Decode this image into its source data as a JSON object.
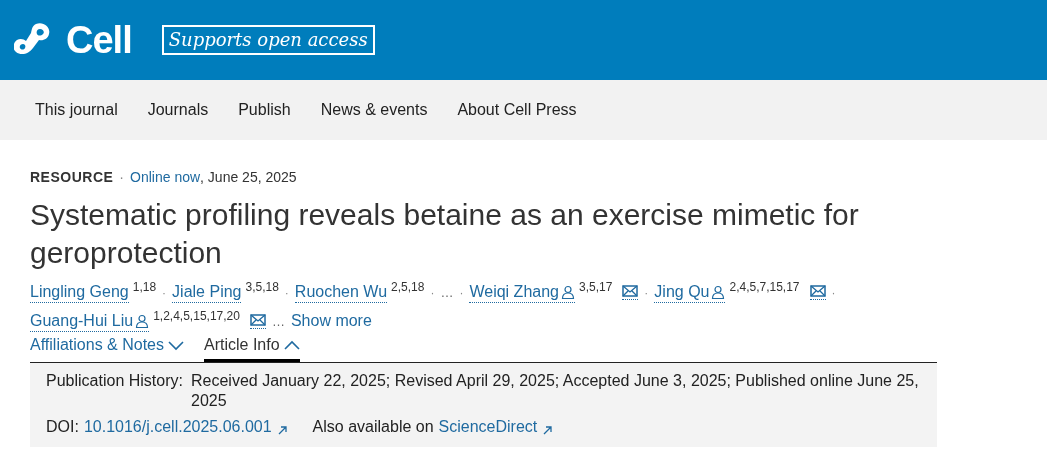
{
  "header": {
    "logo_text": "Cell",
    "badge": "Supports open access"
  },
  "nav": {
    "items": [
      "This journal",
      "Journals",
      "Publish",
      "News & events",
      "About Cell Press"
    ]
  },
  "article": {
    "type": "RESOURCE",
    "status": "Online now",
    "date": ", June 25, 2025",
    "title": "Systematic profiling reveals betaine as an exercise mimetic for geroprotection",
    "authors": [
      {
        "kind": "author",
        "name": "Lingling Geng",
        "affiliations": "1,18",
        "corresponding": false
      },
      {
        "kind": "author",
        "name": "Jiale Ping",
        "affiliations": "3,5,18",
        "corresponding": false
      },
      {
        "kind": "author",
        "name": "Ruochen Wu",
        "affiliations": "2,5,18",
        "corresponding": false
      },
      {
        "kind": "ellipsis",
        "text": "…"
      },
      {
        "kind": "author",
        "name": "Weiqi Zhang",
        "affiliations": "3,5,17",
        "corresponding": true
      },
      {
        "kind": "author",
        "name": "Jing Qu",
        "affiliations": "2,4,5,7,15,17",
        "corresponding": true
      },
      {
        "kind": "author",
        "name": "Guang-Hui Liu",
        "affiliations": "1,2,4,5,15,17,20",
        "corresponding": true
      }
    ],
    "separator": "·",
    "more_ellipsis": "…",
    "show_more": "Show more",
    "tabs": [
      {
        "label": "Affiliations & Notes",
        "selected": false,
        "expanded": false
      },
      {
        "label": "Article Info",
        "selected": true,
        "expanded": true
      }
    ],
    "info": {
      "history_label": "Publication History:",
      "history": "Received January 22, 2025; Revised April 29, 2025; Accepted June 3, 2025; Published online June 25, 2025",
      "doi_label": "DOI:",
      "doi": "10.1016/j.cell.2025.06.001",
      "also_label": "Also available on",
      "also_link": "ScienceDirect"
    }
  }
}
